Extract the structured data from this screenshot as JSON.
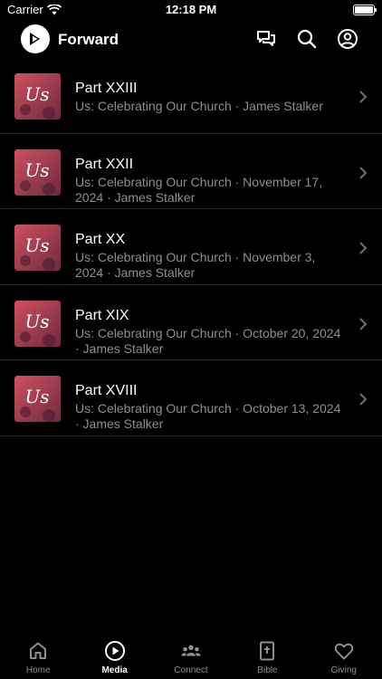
{
  "status": {
    "carrier": "Carrier",
    "time": "12:18 PM"
  },
  "header": {
    "brand": "Forward"
  },
  "items": [
    {
      "title": "Part XXIII",
      "subtitle": "Us: Celebrating Our Church · James Stalker"
    },
    {
      "title": "Part XXII",
      "subtitle": "Us: Celebrating Our Church · November 17, 2024 · James Stalker"
    },
    {
      "title": "Part XX",
      "subtitle": "Us: Celebrating Our Church · November 3, 2024 · James Stalker"
    },
    {
      "title": "Part XIX",
      "subtitle": "Us: Celebrating Our Church · October 20, 2024 · James Stalker"
    },
    {
      "title": "Part XVIII",
      "subtitle": "Us: Celebrating Our Church · October 13, 2024 · James Stalker"
    }
  ],
  "thumbnail": {
    "text": "Us",
    "colors": [
      "#c94a55",
      "#7a2f45"
    ]
  },
  "tabs": [
    {
      "label": "Home",
      "icon": "home-icon",
      "active": false
    },
    {
      "label": "Media",
      "icon": "play-icon",
      "active": true
    },
    {
      "label": "Connect",
      "icon": "people-icon",
      "active": false
    },
    {
      "label": "Bible",
      "icon": "bible-icon",
      "active": false
    },
    {
      "label": "Giving",
      "icon": "heart-icon",
      "active": false
    }
  ]
}
